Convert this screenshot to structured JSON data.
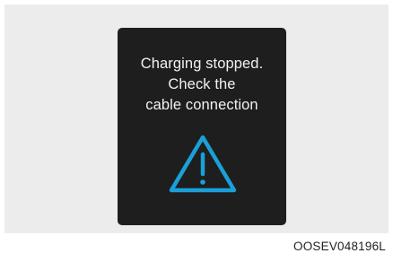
{
  "display": {
    "message_lines": [
      "Charging stopped.",
      "Check the",
      "cable connection"
    ],
    "icon": "warning-triangle-icon",
    "icon_color": "#1aa0d8",
    "screen_color": "#1e1e1e",
    "text_color": "#f2f2f2"
  },
  "figure_code": "OOSEV048196L"
}
